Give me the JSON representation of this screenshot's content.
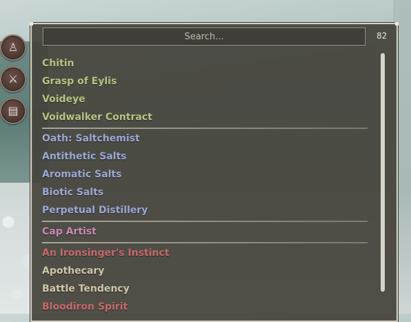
{
  "colors": {
    "green": "#b7c482",
    "blue": "#9ba7d4",
    "pink": "#c98ab4",
    "red": "#c7696b",
    "tan": "#cfc7a6"
  },
  "side_buttons": [
    {
      "icon": "pawn-icon",
      "glyph": "♙"
    },
    {
      "icon": "crossed-swords-icon",
      "glyph": "⚔"
    },
    {
      "icon": "scroll-icon",
      "glyph": "▤"
    }
  ],
  "search": {
    "placeholder": "Search...",
    "value": ""
  },
  "count": "82",
  "groups": [
    {
      "color": "green",
      "items": [
        "Chitin",
        "Grasp of Eylis",
        "Voideye",
        "Voidwalker Contract"
      ]
    },
    {
      "color": "blue",
      "items": [
        "Oath: Saltchemist",
        "Antithetic Salts",
        "Aromatic Salts",
        "Biotic Salts",
        "Perpetual Distillery"
      ]
    },
    {
      "color": "pink",
      "items": [
        "Cap Artist"
      ]
    },
    {
      "color": "mixed",
      "items": [
        {
          "label": "An Ironsinger's Instinct",
          "color": "red"
        },
        {
          "label": "Apothecary",
          "color": "tan"
        },
        {
          "label": "Battle Tendency",
          "color": "tan"
        },
        {
          "label": "Bloodiron Spirit",
          "color": "red"
        }
      ]
    }
  ]
}
